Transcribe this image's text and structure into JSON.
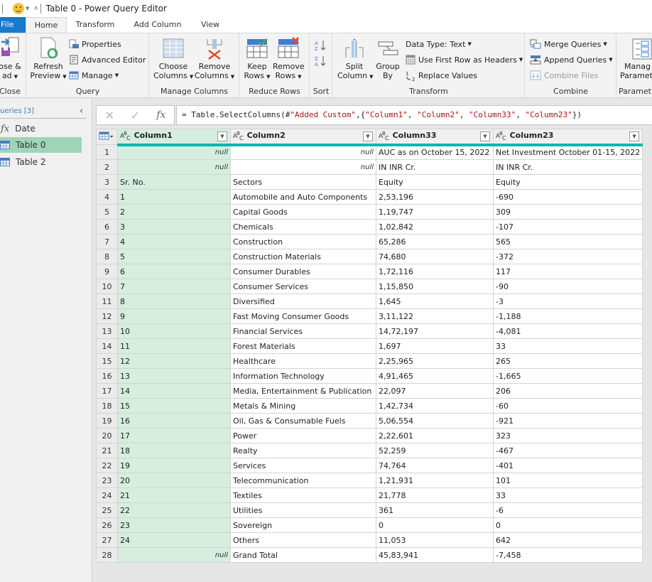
{
  "window": {
    "title": "Table 0 - Power Query Editor"
  },
  "tabs": [
    {
      "label": "File"
    },
    {
      "label": "Home"
    },
    {
      "label": "Transform"
    },
    {
      "label": "Add Column"
    },
    {
      "label": "View"
    }
  ],
  "ribbon": {
    "close": {
      "label_line1": "ose &",
      "label_line2": "ad",
      "group": "Close"
    },
    "query": {
      "refresh_line1": "Refresh",
      "refresh_line2": "Preview",
      "properties": "Properties",
      "advanced_editor": "Advanced Editor",
      "manage": "Manage",
      "group": "Query"
    },
    "manage_columns": {
      "choose_line1": "Choose",
      "choose_line2": "Columns",
      "remove_line1": "Remove",
      "remove_line2": "Columns",
      "group": "Manage Columns"
    },
    "reduce_rows": {
      "keep_line1": "Keep",
      "keep_line2": "Rows",
      "remove_line1": "Remove",
      "remove_line2": "Rows",
      "group": "Reduce Rows"
    },
    "sort": {
      "group": "Sort"
    },
    "transform": {
      "split_line1": "Split",
      "split_line2": "Column",
      "group_line1": "Group",
      "group_line2": "By",
      "data_type": "Data Type: Text",
      "first_row": "Use First Row as Headers",
      "replace": "Replace Values",
      "group": "Transform"
    },
    "combine": {
      "merge": "Merge Queries",
      "append": "Append Queries",
      "combine_files": "Combine Files",
      "group": "Combine"
    },
    "parameters": {
      "line1": "Manag",
      "line2": "Paramet",
      "group": "Paramet"
    }
  },
  "queries": {
    "header": "ueries [3]",
    "items": [
      {
        "label": "Date",
        "type": "function"
      },
      {
        "label": "Table 0",
        "type": "table",
        "selected": true
      },
      {
        "label": "Table 2",
        "type": "table"
      }
    ]
  },
  "formula": {
    "prefix": "= Table.SelectColumns(#",
    "arg1": "\"Added Custom\"",
    "mid": ",{",
    "cols": [
      "\"Column1\"",
      "\"Column2\"",
      "\"Column33\"",
      "\"Column23\""
    ],
    "suffix": "})"
  },
  "grid": {
    "columns": [
      "Column1",
      "Column2",
      "Column33",
      "Column23"
    ],
    "rows": [
      [
        "null",
        "null",
        "AUC as on October 15, 2022",
        "Net Investment October 01-15, 2022"
      ],
      [
        "null",
        "null",
        "IN INR Cr.",
        "IN INR Cr."
      ],
      [
        "Sr. No.",
        "Sectors",
        "Equity",
        "Equity"
      ],
      [
        "1",
        "Automobile and Auto Components",
        "2,53,196",
        "-690"
      ],
      [
        "2",
        "Capital Goods",
        "1,19,747",
        "309"
      ],
      [
        "3",
        "Chemicals",
        "1,02,842",
        "-107"
      ],
      [
        "4",
        "Construction",
        "65,286",
        "565"
      ],
      [
        "5",
        "Construction Materials",
        "74,680",
        "-372"
      ],
      [
        "6",
        "Consumer Durables",
        "1,72,116",
        "117"
      ],
      [
        "7",
        "Consumer Services",
        "1,15,850",
        "-90"
      ],
      [
        "8",
        "Diversified",
        "1,645",
        "-3"
      ],
      [
        "9",
        "Fast Moving Consumer Goods",
        "3,11,122",
        "-1,188"
      ],
      [
        "10",
        "Financial Services",
        "14,72,197",
        "-4,081"
      ],
      [
        "11",
        "Forest Materials",
        "1,697",
        "33"
      ],
      [
        "12",
        "Healthcare",
        "2,25,965",
        "265"
      ],
      [
        "13",
        "Information Technology",
        "4,91,465",
        "-1,665"
      ],
      [
        "14",
        "Media, Entertainment & Publication",
        "22,097",
        "206"
      ],
      [
        "15",
        "Metals & Mining",
        "1,42,734",
        "-60"
      ],
      [
        "16",
        "Oil, Gas & Consumable Fuels",
        "5,06,554",
        "-921"
      ],
      [
        "17",
        "Power",
        "2,22,601",
        "323"
      ],
      [
        "18",
        "Realty",
        "52,259",
        "-467"
      ],
      [
        "19",
        "Services",
        "74,764",
        "-401"
      ],
      [
        "20",
        "Telecommunication",
        "1,21,931",
        "101"
      ],
      [
        "21",
        "Textiles",
        "21,778",
        "33"
      ],
      [
        "22",
        "Utilities",
        "361",
        "-6"
      ],
      [
        "23",
        "Sovereign",
        "0",
        "0"
      ],
      [
        "24",
        "Others",
        "11,053",
        "642"
      ],
      [
        "null",
        "Grand Total",
        "45,83,941",
        "-7,458"
      ]
    ]
  },
  "colors": {
    "accent": "#1979ca",
    "selected_query": "#9fd5b7",
    "selected_column": "#d5eedf",
    "quality_bar": "#01b8aa"
  }
}
